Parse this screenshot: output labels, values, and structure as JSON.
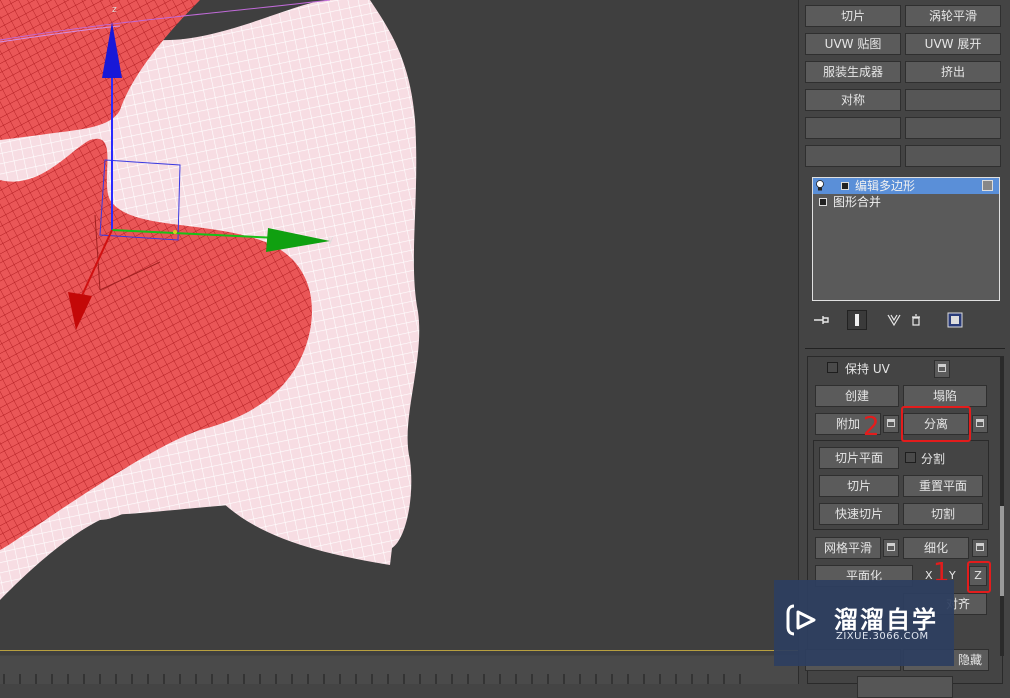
{
  "viewport": {
    "axis_z": "z",
    "axis_y": "y"
  },
  "modifier_buttons": [
    [
      "切片",
      "涡轮平滑"
    ],
    [
      "UVW 贴图",
      "UVW 展开"
    ],
    [
      "服装生成器",
      "挤出"
    ],
    [
      "对称",
      ""
    ],
    [
      "",
      ""
    ],
    [
      "",
      ""
    ]
  ],
  "stack": {
    "items": [
      "编辑多边形",
      "图形合并"
    ]
  },
  "edit_geometry": {
    "preserve_uv": "保持 UV",
    "create": "创建",
    "collapse": "塌陷",
    "attach": "附加",
    "detach": "分离",
    "slice_plane": "切片平面",
    "split": "分割",
    "slice": "切片",
    "reset_plane": "重置平面",
    "quickslice": "快速切片",
    "cut": "切割",
    "meshsmooth": "网格平滑",
    "tessellate": "细化",
    "make_planar": "平面化",
    "x": "X",
    "y": "Y",
    "z": "Z",
    "align_partial": "对齐",
    "hide_partial": "隐藏"
  },
  "annotations": {
    "step1": "1",
    "step2": "2"
  },
  "watermark": {
    "title": "溜溜自学",
    "url": "ZIXUE.3066.COM"
  },
  "colors": {
    "highlight": "#e31c1c",
    "selection": "#5a8fd8",
    "mesh_red": "#e8504f",
    "mesh_pink": "#f6d9df"
  }
}
